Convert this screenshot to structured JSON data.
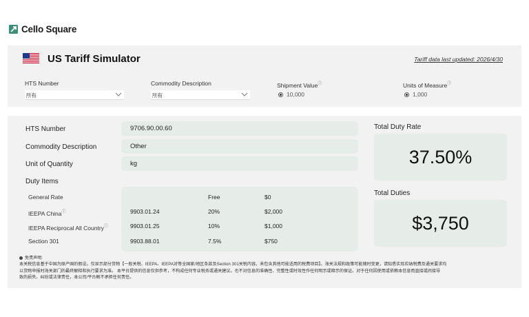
{
  "header": {
    "brand": "Cello Square",
    "brand_color": "#3a8f78"
  },
  "simulator": {
    "flag_icon": "us-flag-icon",
    "title": "US Tariff Simulator",
    "updated": "Tariff data last updated: 2026/4/30"
  },
  "filters": {
    "hts": {
      "label": "HTS Number",
      "value": "所有"
    },
    "commodity": {
      "label": "Commodity Description",
      "value": "所有"
    },
    "shipment": {
      "label": "Shipment Value",
      "info": "ⓘ",
      "value": "10,000"
    },
    "units": {
      "label": "Units of Measure",
      "info": "ⓘ",
      "value": "1,000"
    }
  },
  "details": {
    "hts_label": "HTS Number",
    "hts_value": "9706.90.00.60",
    "commodity_label": "Commodity Description",
    "commodity_value": "Other",
    "unit_label": "Unit of Quantity",
    "unit_value": "kg",
    "duty_items_label": "Duty Items"
  },
  "duty_items": [
    {
      "name": "General Rate",
      "info": "",
      "hts": "",
      "rate": "Free",
      "amount": "$0"
    },
    {
      "name": "IEEPA China",
      "info": "ⓘ",
      "hts": "9903.01.24",
      "rate": "20%",
      "amount": "$2,000"
    },
    {
      "name": "IEEPA Reciprocal All Country",
      "info": "ⓘ",
      "hts": "9903.01.25",
      "rate": "10%",
      "amount": "$1,000"
    },
    {
      "name": "Section 301",
      "info": "",
      "hts": "9903.88.01",
      "rate": "7.5%",
      "amount": "$750"
    }
  ],
  "summary": {
    "rate_label": "Total Duty Rate",
    "rate_value": "37.50%",
    "duties_label": "Total Duties",
    "duties_value": "$3,750"
  },
  "disclaimer": {
    "title": "免责声明:",
    "line1": "本关税信息基于中国为原产国的假设。仅显示部分货物【一般关税、IEEPA、IEEPA对等全国家/地区条款及Section 301关税内容。未包含其他可能适用的税费项目】。海关法规和政策可能随时变更，请知悉实际应纳税费及通关要求均",
    "line2": "以货物申报时海关部门的最终解释和执行要求为准。 本平台提供的信息仅供参考，不构成任何专业税务或通关建议。也不对信息的准确性、完整性或时效性作任何明示或暗示的保证。对于任何因使用或依赖本信息而直接或间接导",
    "line3": "致的损失、纠纷或法律责任，本公司/平台概不承担任何责任。"
  }
}
